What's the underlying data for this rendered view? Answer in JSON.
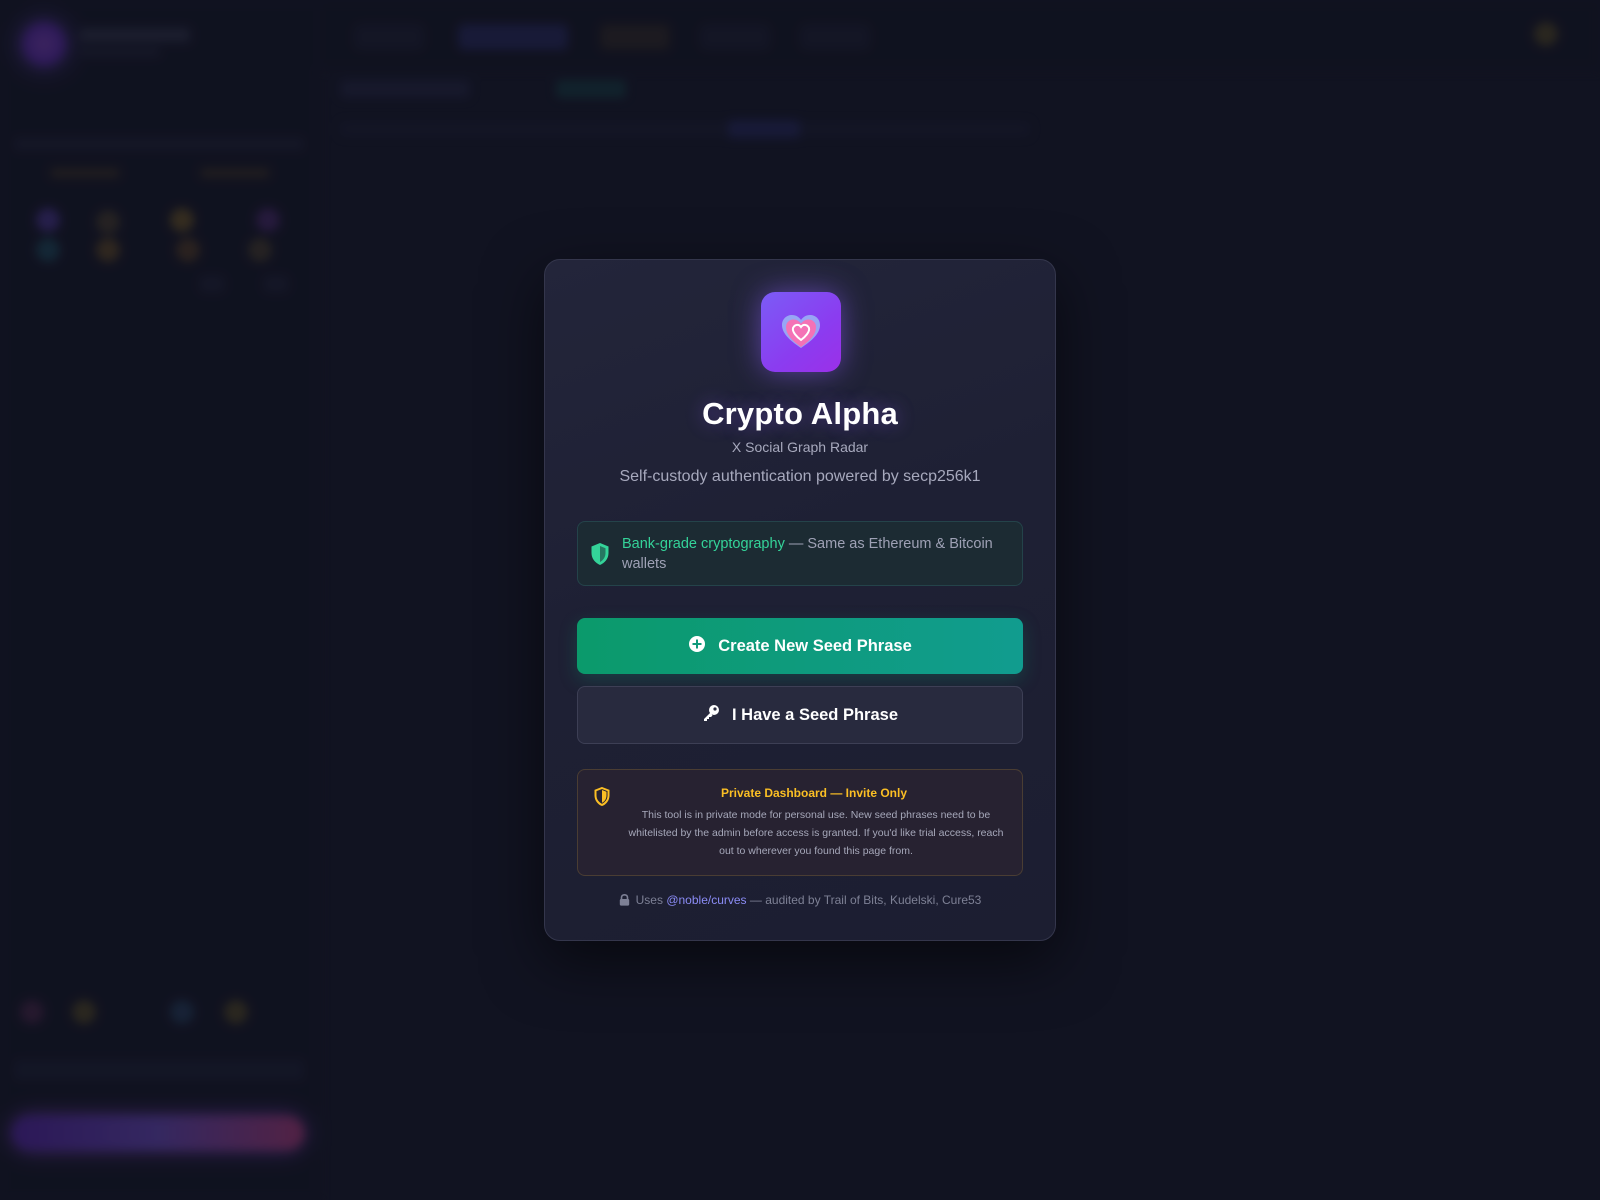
{
  "modal": {
    "title": "Crypto Alpha",
    "subtitle": "X Social Graph Radar",
    "tagline": "Self-custody authentication powered by secp256k1",
    "security": {
      "highlight": "Bank-grade cryptography",
      "text": " — Same as Ethereum & Bitcoin wallets"
    },
    "create_button_label": "Create New Seed Phrase",
    "have_button_label": "I Have a Seed Phrase",
    "invite": {
      "title": "Private Dashboard — Invite Only",
      "body": "This tool is in private mode for personal use. New seed phrases need to be whitelisted by the admin before access is granted. If you'd like trial access, reach out to wherever you found this page from."
    },
    "footer": {
      "prefix": "Uses ",
      "library": "@noble/curves",
      "suffix": " — audited by Trail of Bits, Kudelski, Cure53"
    }
  },
  "icons": {
    "app_icon": "heart-icon",
    "security_icon": "shield-check-icon",
    "create_icon": "plus-circle-icon",
    "have_icon": "key-icon",
    "invite_icon": "shield-half-icon",
    "footer_icon": "lock-icon"
  },
  "colors": {
    "accent_purple": "#8b5cf6",
    "accent_green": "#10a37f",
    "highlight_green": "#34d399",
    "warning_yellow": "#fbbf24",
    "link_indigo": "#8b8cf6"
  }
}
